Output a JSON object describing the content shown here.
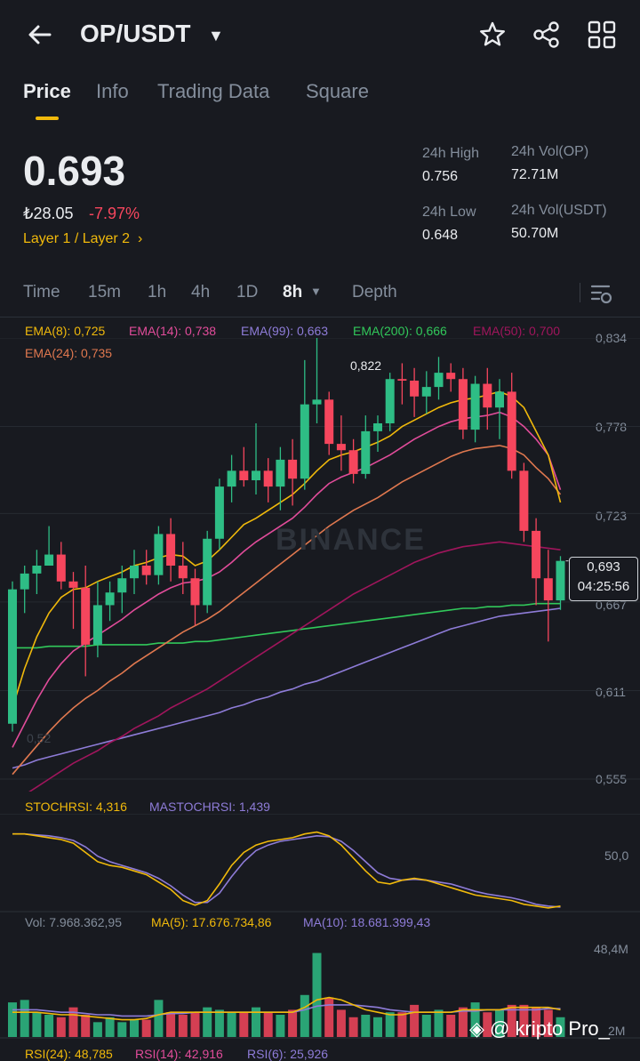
{
  "header": {
    "pair": "OP/USDT",
    "icons": [
      "back-arrow-icon",
      "caret-down-icon",
      "star-icon",
      "share-icon",
      "grid-icon"
    ]
  },
  "tabs": [
    "Price",
    "Info",
    "Trading Data",
    "Square"
  ],
  "ticker": {
    "price": "0.693",
    "fiat": "₺28.05",
    "change": "-7.97%",
    "tags": "Layer 1 / Layer 2",
    "high_label": "24h High",
    "high": "0.756",
    "low_label": "24h Low",
    "low": "0.648",
    "vol_op_label": "24h Vol(OP)",
    "vol_op": "72.71M",
    "vol_usdt_label": "24h Vol(USDT)",
    "vol_usdt": "50.70M"
  },
  "intervals": [
    "Time",
    "15m",
    "1h",
    "4h",
    "1D",
    "8h",
    "Depth"
  ],
  "active_interval": "8h",
  "ema_labels": {
    "ema8": "EMA(8): 0,725",
    "ema14": "EMA(14): 0,738",
    "ema99": "EMA(99): 0,663",
    "ema200": "EMA(200): 0,666",
    "ema50": "EMA(50): 0,700",
    "ema24": "EMA(24): 0,735"
  },
  "price_axis": [
    "0,834",
    "0,778",
    "0,723",
    "0,667",
    "0,611",
    "0,555"
  ],
  "high_marker": "0,822",
  "current_tag": {
    "price": "0,693",
    "countdown": "04:25:56"
  },
  "watermark": "BINANCE",
  "low_marker": "0,52",
  "stoch": {
    "stochrsi": "STOCHRSI: 4,316",
    "mastochrsi": "MASTOCHRSI: 1,439",
    "axis": "50,0"
  },
  "volume": {
    "vol": "Vol: 7.968.362,95",
    "ma5": "MA(5): 17.676.734,86",
    "ma10": "MA(10): 18.681.399,43",
    "axis_top": "48,4M",
    "axis_bottom": "2M"
  },
  "rsi": {
    "rsi24": "RSI(24): 48,785",
    "rsi14": "RSI(14): 42,916",
    "rsi6": "RSI(6): 25,926"
  },
  "brand": "@ kripto Pro_",
  "colors": {
    "up": "#2ebd85",
    "down": "#f6465d",
    "accent": "#f0b90b",
    "bg": "#181a20"
  },
  "chart_data": {
    "type": "candlestick",
    "ylim": [
      0.52,
      0.845
    ],
    "candles": [
      {
        "o": 0.59,
        "h": 0.68,
        "l": 0.585,
        "c": 0.675
      },
      {
        "o": 0.675,
        "h": 0.69,
        "l": 0.66,
        "c": 0.685
      },
      {
        "o": 0.685,
        "h": 0.7,
        "l": 0.672,
        "c": 0.69
      },
      {
        "o": 0.69,
        "h": 0.715,
        "l": 0.69,
        "c": 0.697
      },
      {
        "o": 0.697,
        "h": 0.705,
        "l": 0.675,
        "c": 0.68
      },
      {
        "o": 0.68,
        "h": 0.686,
        "l": 0.65,
        "c": 0.676
      },
      {
        "o": 0.676,
        "h": 0.69,
        "l": 0.62,
        "c": 0.64
      },
      {
        "o": 0.64,
        "h": 0.68,
        "l": 0.632,
        "c": 0.665
      },
      {
        "o": 0.665,
        "h": 0.68,
        "l": 0.655,
        "c": 0.673
      },
      {
        "o": 0.673,
        "h": 0.69,
        "l": 0.66,
        "c": 0.682
      },
      {
        "o": 0.682,
        "h": 0.7,
        "l": 0.672,
        "c": 0.69
      },
      {
        "o": 0.69,
        "h": 0.7,
        "l": 0.678,
        "c": 0.684
      },
      {
        "o": 0.684,
        "h": 0.715,
        "l": 0.678,
        "c": 0.71
      },
      {
        "o": 0.71,
        "h": 0.72,
        "l": 0.68,
        "c": 0.69
      },
      {
        "o": 0.69,
        "h": 0.705,
        "l": 0.672,
        "c": 0.682
      },
      {
        "o": 0.682,
        "h": 0.688,
        "l": 0.652,
        "c": 0.665
      },
      {
        "o": 0.665,
        "h": 0.712,
        "l": 0.66,
        "c": 0.707
      },
      {
        "o": 0.707,
        "h": 0.745,
        "l": 0.7,
        "c": 0.74
      },
      {
        "o": 0.74,
        "h": 0.76,
        "l": 0.73,
        "c": 0.75
      },
      {
        "o": 0.75,
        "h": 0.765,
        "l": 0.74,
        "c": 0.744
      },
      {
        "o": 0.744,
        "h": 0.78,
        "l": 0.735,
        "c": 0.75
      },
      {
        "o": 0.75,
        "h": 0.758,
        "l": 0.73,
        "c": 0.74
      },
      {
        "o": 0.74,
        "h": 0.765,
        "l": 0.725,
        "c": 0.757
      },
      {
        "o": 0.757,
        "h": 0.77,
        "l": 0.728,
        "c": 0.745
      },
      {
        "o": 0.745,
        "h": 0.82,
        "l": 0.738,
        "c": 0.792
      },
      {
        "o": 0.792,
        "h": 0.835,
        "l": 0.78,
        "c": 0.795
      },
      {
        "o": 0.795,
        "h": 0.8,
        "l": 0.76,
        "c": 0.767
      },
      {
        "o": 0.767,
        "h": 0.785,
        "l": 0.75,
        "c": 0.763
      },
      {
        "o": 0.763,
        "h": 0.77,
        "l": 0.742,
        "c": 0.748
      },
      {
        "o": 0.748,
        "h": 0.785,
        "l": 0.745,
        "c": 0.775
      },
      {
        "o": 0.775,
        "h": 0.785,
        "l": 0.762,
        "c": 0.78
      },
      {
        "o": 0.78,
        "h": 0.812,
        "l": 0.775,
        "c": 0.808
      },
      {
        "o": 0.808,
        "h": 0.818,
        "l": 0.792,
        "c": 0.807
      },
      {
        "o": 0.807,
        "h": 0.815,
        "l": 0.784,
        "c": 0.797
      },
      {
        "o": 0.797,
        "h": 0.813,
        "l": 0.786,
        "c": 0.803
      },
      {
        "o": 0.803,
        "h": 0.822,
        "l": 0.795,
        "c": 0.812
      },
      {
        "o": 0.812,
        "h": 0.818,
        "l": 0.8,
        "c": 0.808
      },
      {
        "o": 0.808,
        "h": 0.815,
        "l": 0.77,
        "c": 0.776
      },
      {
        "o": 0.776,
        "h": 0.81,
        "l": 0.768,
        "c": 0.805
      },
      {
        "o": 0.805,
        "h": 0.815,
        "l": 0.776,
        "c": 0.79
      },
      {
        "o": 0.79,
        "h": 0.808,
        "l": 0.77,
        "c": 0.8
      },
      {
        "o": 0.8,
        "h": 0.812,
        "l": 0.745,
        "c": 0.75
      },
      {
        "o": 0.75,
        "h": 0.755,
        "l": 0.705,
        "c": 0.712
      },
      {
        "o": 0.712,
        "h": 0.72,
        "l": 0.665,
        "c": 0.682
      },
      {
        "o": 0.682,
        "h": 0.7,
        "l": 0.642,
        "c": 0.668
      },
      {
        "o": 0.668,
        "h": 0.696,
        "l": 0.662,
        "c": 0.693
      }
    ],
    "ema8": [
      0.6,
      0.625,
      0.645,
      0.66,
      0.67,
      0.675,
      0.676,
      0.68,
      0.683,
      0.686,
      0.69,
      0.692,
      0.695,
      0.697,
      0.696,
      0.69,
      0.693,
      0.7,
      0.708,
      0.716,
      0.72,
      0.725,
      0.73,
      0.735,
      0.742,
      0.75,
      0.757,
      0.76,
      0.762,
      0.765,
      0.768,
      0.772,
      0.778,
      0.782,
      0.786,
      0.79,
      0.793,
      0.795,
      0.796,
      0.798,
      0.8,
      0.797,
      0.79,
      0.775,
      0.76,
      0.73
    ],
    "ema14": [
      0.575,
      0.59,
      0.605,
      0.618,
      0.628,
      0.636,
      0.641,
      0.646,
      0.651,
      0.656,
      0.662,
      0.667,
      0.672,
      0.676,
      0.679,
      0.68,
      0.682,
      0.686,
      0.692,
      0.699,
      0.705,
      0.71,
      0.715,
      0.72,
      0.727,
      0.735,
      0.742,
      0.746,
      0.749,
      0.752,
      0.756,
      0.76,
      0.765,
      0.77,
      0.774,
      0.778,
      0.781,
      0.783,
      0.784,
      0.785,
      0.787,
      0.784,
      0.778,
      0.77,
      0.76,
      0.738
    ],
    "ema24": [
      0.558,
      0.567,
      0.576,
      0.585,
      0.593,
      0.6,
      0.606,
      0.611,
      0.617,
      0.622,
      0.628,
      0.633,
      0.638,
      0.643,
      0.648,
      0.652,
      0.656,
      0.661,
      0.667,
      0.673,
      0.679,
      0.685,
      0.691,
      0.697,
      0.703,
      0.709,
      0.715,
      0.72,
      0.725,
      0.729,
      0.733,
      0.738,
      0.743,
      0.747,
      0.751,
      0.755,
      0.759,
      0.762,
      0.764,
      0.765,
      0.766,
      0.764,
      0.76,
      0.752,
      0.745,
      0.735
    ],
    "ema50": [
      0.54,
      0.545,
      0.55,
      0.555,
      0.56,
      0.565,
      0.569,
      0.573,
      0.578,
      0.582,
      0.587,
      0.591,
      0.595,
      0.6,
      0.604,
      0.608,
      0.612,
      0.617,
      0.622,
      0.627,
      0.632,
      0.637,
      0.642,
      0.647,
      0.652,
      0.657,
      0.662,
      0.667,
      0.672,
      0.676,
      0.68,
      0.684,
      0.688,
      0.692,
      0.695,
      0.698,
      0.7,
      0.702,
      0.703,
      0.704,
      0.705,
      0.704,
      0.703,
      0.702,
      0.701,
      0.7
    ],
    "ema99": [
      0.562,
      0.564,
      0.567,
      0.569,
      0.571,
      0.573,
      0.575,
      0.577,
      0.579,
      0.581,
      0.583,
      0.585,
      0.587,
      0.589,
      0.591,
      0.593,
      0.595,
      0.597,
      0.6,
      0.602,
      0.605,
      0.607,
      0.61,
      0.612,
      0.615,
      0.617,
      0.62,
      0.623,
      0.626,
      0.629,
      0.632,
      0.635,
      0.638,
      0.641,
      0.644,
      0.647,
      0.65,
      0.652,
      0.654,
      0.656,
      0.658,
      0.659,
      0.66,
      0.661,
      0.662,
      0.663
    ],
    "ema200": [
      0.638,
      0.638,
      0.638,
      0.639,
      0.639,
      0.639,
      0.639,
      0.64,
      0.64,
      0.64,
      0.64,
      0.64,
      0.641,
      0.641,
      0.641,
      0.642,
      0.642,
      0.643,
      0.644,
      0.645,
      0.646,
      0.647,
      0.648,
      0.649,
      0.65,
      0.651,
      0.652,
      0.653,
      0.654,
      0.655,
      0.656,
      0.657,
      0.658,
      0.659,
      0.66,
      0.661,
      0.662,
      0.663,
      0.663,
      0.664,
      0.664,
      0.665,
      0.665,
      0.666,
      0.666,
      0.666
    ],
    "stoch_k": [
      82,
      82,
      80,
      78,
      76,
      72,
      62,
      52,
      48,
      46,
      42,
      38,
      30,
      22,
      10,
      5,
      10,
      28,
      48,
      62,
      70,
      74,
      76,
      78,
      82,
      84,
      80,
      70,
      56,
      42,
      30,
      28,
      32,
      34,
      32,
      28,
      24,
      20,
      16,
      14,
      12,
      10,
      6,
      4,
      2,
      4
    ],
    "stoch_d": [
      82,
      82,
      81,
      80,
      78,
      75,
      68,
      58,
      52,
      48,
      44,
      40,
      34,
      26,
      16,
      8,
      8,
      18,
      36,
      52,
      64,
      70,
      74,
      76,
      78,
      80,
      79,
      74,
      64,
      52,
      40,
      34,
      32,
      33,
      32,
      30,
      28,
      24,
      20,
      17,
      15,
      13,
      10,
      6,
      4,
      3
    ],
    "volume": [
      14,
      15,
      10,
      9,
      8,
      12,
      9,
      6,
      8,
      6,
      7,
      7,
      15,
      10,
      9,
      10,
      12,
      11,
      10,
      10,
      12,
      10,
      9,
      11,
      17,
      34,
      16,
      11,
      8,
      9,
      8,
      10,
      10,
      13,
      9,
      11,
      9,
      12,
      14,
      10,
      11,
      13,
      13,
      12,
      11,
      8
    ],
    "vol_ma5": [
      10,
      10,
      10,
      9.5,
      9,
      9,
      8.5,
      8,
      7.5,
      7,
      7,
      7.5,
      9,
      10,
      10,
      10,
      10,
      10,
      10,
      10,
      10,
      10,
      10,
      10,
      12,
      15,
      16,
      15,
      13,
      11,
      10,
      9,
      9,
      10,
      10,
      10,
      10,
      11,
      11,
      11,
      11,
      12,
      12,
      12,
      12,
      11
    ],
    "vol_ma10": [
      11,
      11,
      11,
      10.5,
      10,
      10,
      9.5,
      9,
      9,
      8.5,
      8.5,
      8.5,
      9,
      9.5,
      9.5,
      10,
      10,
      10,
      10,
      10,
      10,
      10,
      10,
      10,
      11,
      12.5,
      13,
      13,
      13,
      12.5,
      12,
      11,
      10.5,
      10,
      10,
      10,
      10,
      10.5,
      10.5,
      11,
      11,
      11,
      11,
      11,
      11.5,
      11.5
    ]
  }
}
